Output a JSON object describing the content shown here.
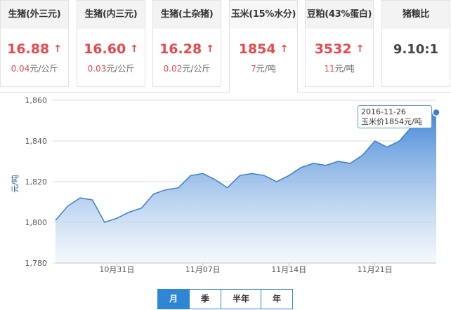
{
  "cards": [
    {
      "title": "生猪(外三元)",
      "price": "16.88",
      "arrow": "↑",
      "change_value": "0.04",
      "change_unit": "元/公斤"
    },
    {
      "title": "生猪(内三元)",
      "price": "16.60",
      "arrow": "↑",
      "change_value": "0.03",
      "change_unit": "元/公斤"
    },
    {
      "title": "生猪(土杂猪)",
      "price": "16.28",
      "arrow": "↑",
      "change_value": "0.02",
      "change_unit": "元/公斤"
    },
    {
      "title": "玉米(15%水分)",
      "price": "1854",
      "arrow": "↑",
      "change_value": "7",
      "change_unit": "元/吨"
    },
    {
      "title": "豆粕(43%蛋白)",
      "price": "3532",
      "arrow": "↑",
      "change_value": "11",
      "change_unit": "元/吨"
    },
    {
      "title": "猪粮比",
      "price": "9.10:1",
      "arrow": "",
      "change_value": "",
      "change_unit": ""
    }
  ],
  "active_card_index": 3,
  "tooltip": {
    "date": "2016-11-26",
    "text": "玉米价1854元/吨"
  },
  "tabs": [
    {
      "label": "月",
      "active": true
    },
    {
      "label": "季",
      "active": false
    },
    {
      "label": "半年",
      "active": false
    },
    {
      "label": "年",
      "active": false
    }
  ],
  "colors": {
    "up": "#e9474c",
    "accent": "#2f86d4",
    "line": "#3a7fd0",
    "area_top": "#3d82d4",
    "area_bottom": "#ebf3fb"
  },
  "chart_data": {
    "type": "area",
    "ylabel": "元/吨",
    "ylim": [
      1780,
      1860
    ],
    "yticks": [
      1780,
      1800,
      1820,
      1840,
      1860
    ],
    "ytick_labels": [
      "1,780",
      "1,800",
      "1,820",
      "1,840",
      "1,860"
    ],
    "xtick_labels": [
      {
        "label": "10月31日",
        "date": "2016-10-31"
      },
      {
        "label": "11月07日",
        "date": "2016-11-07"
      },
      {
        "label": "11月14日",
        "date": "2016-11-14"
      },
      {
        "label": "11月21日",
        "date": "2016-11-21"
      }
    ],
    "grid": true,
    "series": [
      {
        "x": [
          "2016-10-26",
          "2016-10-27",
          "2016-10-28",
          "2016-10-29",
          "2016-10-30",
          "2016-10-31",
          "2016-11-01",
          "2016-11-02",
          "2016-11-03",
          "2016-11-04",
          "2016-11-05",
          "2016-11-06",
          "2016-11-07",
          "2016-11-08",
          "2016-11-09",
          "2016-11-10",
          "2016-11-11",
          "2016-11-12",
          "2016-11-13",
          "2016-11-14",
          "2016-11-15",
          "2016-11-16",
          "2016-11-17",
          "2016-11-18",
          "2016-11-19",
          "2016-11-20",
          "2016-11-21",
          "2016-11-22",
          "2016-11-23",
          "2016-11-24",
          "2016-11-25",
          "2016-11-26"
        ],
        "values": [
          1801,
          1808,
          1812,
          1811,
          1800,
          1802,
          1805,
          1807,
          1814,
          1816,
          1817,
          1823,
          1824,
          1821,
          1817,
          1823,
          1824,
          1823,
          1820,
          1823,
          1827,
          1829,
          1828,
          1830,
          1829,
          1833,
          1840,
          1837,
          1840,
          1847,
          1853,
          1854
        ]
      }
    ]
  }
}
